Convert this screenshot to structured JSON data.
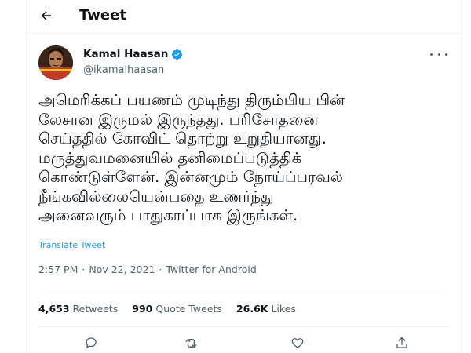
{
  "header": {
    "title": "Tweet"
  },
  "author": {
    "name": "Kamal Haasan",
    "handle": "@ikamalhaasan"
  },
  "tweet": {
    "lines": [
      "அமெரிக்கப் பயணம் முடிந்து திரும்பிய பின்",
      "லேசான இருமல் இருந்தது. பரிசோதனை",
      "செய்ததில் கோவிட் தொற்று உறுதியானது.",
      "மருத்துவமனையில் தனிமைப்படுத்திக்",
      "கொண்டுள்ளேன். இன்னமும் நோய்ப்பரவல்",
      "நீங்கவில்லையென்பதை உணர்ந்து",
      "அனைவரும் பாதுகாப்பாக இருங்கள்."
    ],
    "translate_label": "Translate Tweet",
    "time": "2:57 PM",
    "date": "Nov 22, 2021",
    "source": "Twitter for Android",
    "separator": "·"
  },
  "stats": {
    "retweets_count": "4,653",
    "retweets_label": "Retweets",
    "quotes_count": "990",
    "quotes_label": "Quote Tweets",
    "likes_count": "26.6K",
    "likes_label": "Likes"
  },
  "icons": {
    "back": "arrow-left-icon",
    "verified": "verified-badge-icon",
    "more": "more-options-icon",
    "reply": "reply-icon",
    "retweet": "retweet-icon",
    "like": "heart-icon",
    "share": "share-icon"
  },
  "colors": {
    "accent": "#1d9bf0",
    "text": "#0f1419",
    "muted": "#536471"
  }
}
